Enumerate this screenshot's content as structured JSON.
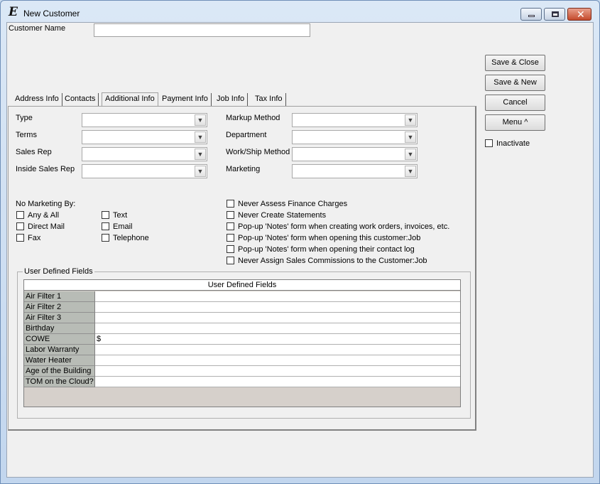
{
  "window": {
    "title": "New Customer"
  },
  "customer_name": {
    "label": "Customer Name",
    "value": ""
  },
  "buttons": {
    "save_close": "Save & Close",
    "save_new": "Save & New",
    "cancel": "Cancel",
    "menu": "Menu ^"
  },
  "inactivate": {
    "label": "Inactivate",
    "checked": false
  },
  "tabs": [
    {
      "label": "Address Info",
      "active": false
    },
    {
      "label": "Contacts",
      "active": false
    },
    {
      "label": "Additional Info",
      "active": true
    },
    {
      "label": "Payment Info",
      "active": false
    },
    {
      "label": "Job Info",
      "active": false
    },
    {
      "label": "Tax Info",
      "active": false
    }
  ],
  "fields_left": [
    {
      "label": "Type",
      "value": ""
    },
    {
      "label": "Terms",
      "value": ""
    },
    {
      "label": "Sales Rep",
      "value": ""
    },
    {
      "label": "Inside Sales Rep",
      "value": ""
    }
  ],
  "fields_right": [
    {
      "label": "Markup Method",
      "value": ""
    },
    {
      "label": "Department",
      "value": ""
    },
    {
      "label": "Work/Ship Method",
      "value": ""
    },
    {
      "label": "Marketing",
      "value": ""
    }
  ],
  "no_marketing": {
    "label": "No Marketing By:",
    "col1": [
      "Any & All",
      "Direct Mail",
      "Fax"
    ],
    "col2": [
      "Text",
      "Email",
      "Telephone"
    ]
  },
  "options": [
    "Never Assess Finance Charges",
    "Never Create Statements",
    "Pop-up 'Notes' form when creating work orders, invoices, etc.",
    "Pop-up 'Notes' form when opening this customer:Job",
    "Pop-up 'Notes' form when opening their contact log",
    "Never Assign Sales Commissions to the Customer:Job"
  ],
  "udf": {
    "group_label": "User Defined Fields",
    "grid_header": "User Defined Fields",
    "rows": [
      {
        "label": "Air Filter 1",
        "value": ""
      },
      {
        "label": "Air Filter 2",
        "value": ""
      },
      {
        "label": "Air Filter 3",
        "value": ""
      },
      {
        "label": "Birthday",
        "value": ""
      },
      {
        "label": "COWE",
        "value": "$"
      },
      {
        "label": "Labor Warranty",
        "value": ""
      },
      {
        "label": "Water Heater",
        "value": ""
      },
      {
        "label": "Age of the Building",
        "value": ""
      },
      {
        "label": "TOM on the Cloud?",
        "value": ""
      }
    ]
  }
}
